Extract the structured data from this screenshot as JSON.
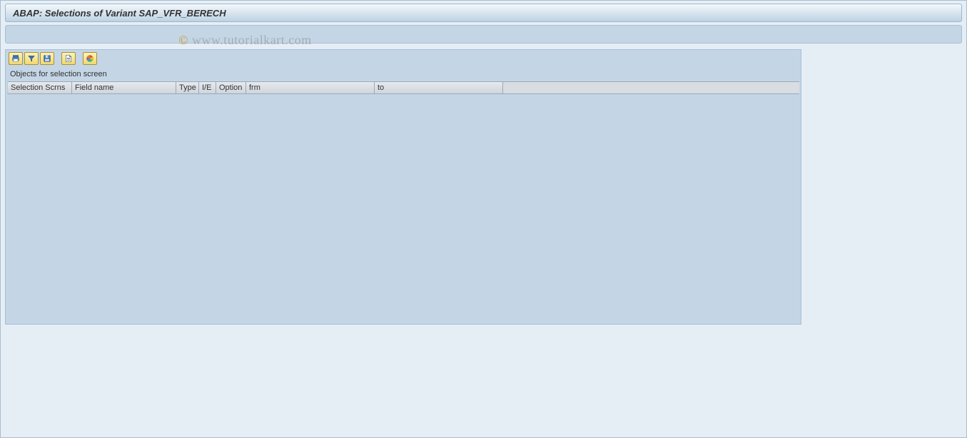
{
  "title": "ABAP: Selections of Variant SAP_VFR_BERECH",
  "watermark": {
    "copy": "©",
    "text": " www.tutorialkart.com"
  },
  "toolbar": {
    "btn_print": "print-icon",
    "btn_filter": "filter-icon",
    "btn_save": "save-icon",
    "btn_page": "page-icon",
    "btn_color": "color-icon"
  },
  "section_label": "Objects for selection screen",
  "grid": {
    "columns": {
      "selection": "Selection Scrns",
      "field": "Field name",
      "type": "Type",
      "ie": "I/E",
      "option": "Option",
      "frm": "frm",
      "to": "to"
    },
    "rows": []
  }
}
